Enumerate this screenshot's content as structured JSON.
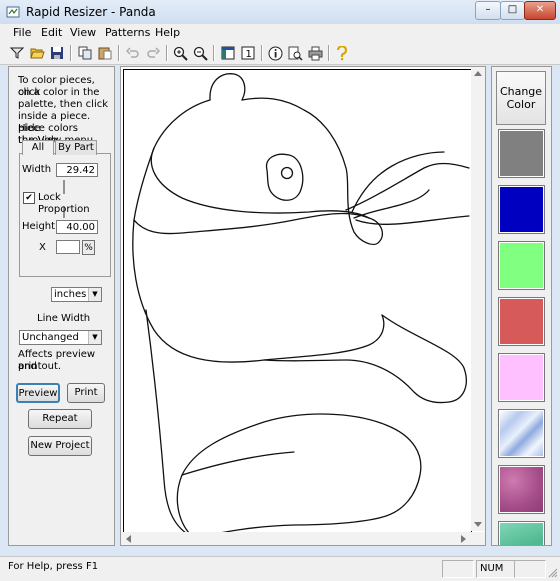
{
  "window": {
    "title": "Rapid Resizer - Panda",
    "minimize": "–",
    "maximize": "□",
    "close": "✕"
  },
  "menu": [
    "File",
    "Edit",
    "View",
    "Patterns",
    "Help"
  ],
  "toolbar": {
    "icons": [
      "filter-icon",
      "open-folder-icon",
      "save-icon",
      "copy-icon",
      "paste-icon",
      "undo-icon",
      "redo-icon",
      "zoom-in-icon",
      "zoom-out-icon",
      "fit-page-icon",
      "actual-size-icon",
      "info-icon",
      "print-preview-icon",
      "print-icon",
      "help-icon"
    ]
  },
  "left_panel": {
    "instructions": [
      "To color pieces, click",
      "on a color in the",
      "palette, then click",
      "inside a piece. Hide",
      "piece colors through",
      "the View menu."
    ],
    "tabs": [
      "All",
      "By Part"
    ],
    "width_label": "Width",
    "width_value": "29.42",
    "lock_label": "Lock Proportion",
    "lock_checked": "✔",
    "height_label": "Height",
    "height_value": "40.00",
    "scale_label": "X",
    "scale_value": "",
    "percent_label": "%",
    "units_value": "inches",
    "line_width_label": "Line Width",
    "line_width_value": "Unchanged",
    "affects_note": [
      "Affects preview and",
      "printout."
    ],
    "preview_button": "Preview",
    "print_button": "Print",
    "repeat_button": "Repeat",
    "new_project_button": "New Project"
  },
  "palette": {
    "change_color_button": [
      "Change",
      "Color"
    ],
    "swatches": [
      {
        "name": "gray",
        "color": "#808080"
      },
      {
        "name": "blue",
        "color": "#0000c0"
      },
      {
        "name": "light-green",
        "color": "#80ff80"
      },
      {
        "name": "red",
        "color": "#d75a5a"
      },
      {
        "name": "pink",
        "color": "#ffc0ff"
      },
      {
        "name": "blue-marble-texture",
        "color": "#b7c9ee"
      },
      {
        "name": "purple-texture",
        "color": "#b85e98"
      },
      {
        "name": "green-texture",
        "color": "#5fc4a0"
      }
    ]
  },
  "statusbar": {
    "help_text": "For Help, press F1",
    "num_indicator": "NUM"
  }
}
